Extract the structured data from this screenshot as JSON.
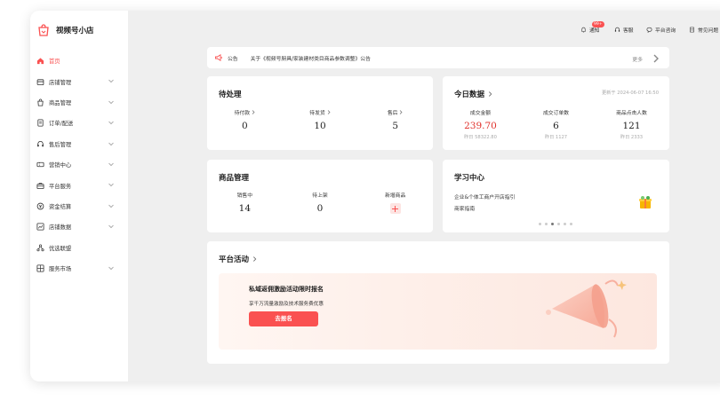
{
  "app": {
    "name": "视频号小店"
  },
  "sidebar": {
    "items": [
      {
        "label": "首页",
        "icon": "home-icon",
        "active": true,
        "expandable": false
      },
      {
        "label": "店铺管理",
        "icon": "store-icon",
        "expandable": true
      },
      {
        "label": "商品管理",
        "icon": "bag-icon",
        "expandable": true
      },
      {
        "label": "订单/配送",
        "icon": "order-icon",
        "expandable": true
      },
      {
        "label": "售后管理",
        "icon": "headset-icon",
        "expandable": true
      },
      {
        "label": "营销中心",
        "icon": "ticket-icon",
        "expandable": true
      },
      {
        "label": "平台服务",
        "icon": "briefcase-icon",
        "expandable": true
      },
      {
        "label": "资金结算",
        "icon": "coin-icon",
        "expandable": true
      },
      {
        "label": "店铺数据",
        "icon": "chart-icon",
        "expandable": true
      },
      {
        "label": "优选联盟",
        "icon": "network-icon",
        "expandable": false
      },
      {
        "label": "服务市场",
        "icon": "grid-icon",
        "expandable": true
      }
    ]
  },
  "topbar": {
    "notify_label": "通知",
    "notify_badge": "99+",
    "service_label": "客服",
    "consult_label": "平台咨询",
    "faq_label": "常见问题"
  },
  "notice": {
    "tag": "公告",
    "text": "关于《视频号厨具/家装建材类目商品参数调整》公告",
    "more": "更多"
  },
  "pending": {
    "title": "待处理",
    "items": [
      {
        "label": "待付款",
        "value": "0"
      },
      {
        "label": "待发货",
        "value": "10"
      },
      {
        "label": "售后",
        "value": "5"
      }
    ]
  },
  "today": {
    "title": "今日数据",
    "updated": "更新于 2024-06-07 16:50",
    "items": [
      {
        "label": "成交金额",
        "value": "239.70",
        "sub": "昨日 58322.80"
      },
      {
        "label": "成交订单数",
        "value": "6",
        "sub": "昨日 1127"
      },
      {
        "label": "商品点击人数",
        "value": "121",
        "sub": "昨日 2333"
      }
    ]
  },
  "goods": {
    "title": "商品管理",
    "items": [
      {
        "label": "销售中",
        "value": "14"
      },
      {
        "label": "待上架",
        "value": "0"
      }
    ],
    "add_label": "新增商品"
  },
  "learning": {
    "title": "学习中心",
    "line1": "企业&个体工商户开店指引",
    "line2": "商家指南",
    "active_dot": 2
  },
  "activity": {
    "title": "平台活动",
    "banner_title": "私域返佣激励活动限时报名",
    "banner_sub": "享千万流量激励及技术服务费优惠",
    "banner_button": "去报名"
  },
  "colors": {
    "accent": "#fa5151",
    "value_red": "#e0302a",
    "background": "#efefef"
  }
}
